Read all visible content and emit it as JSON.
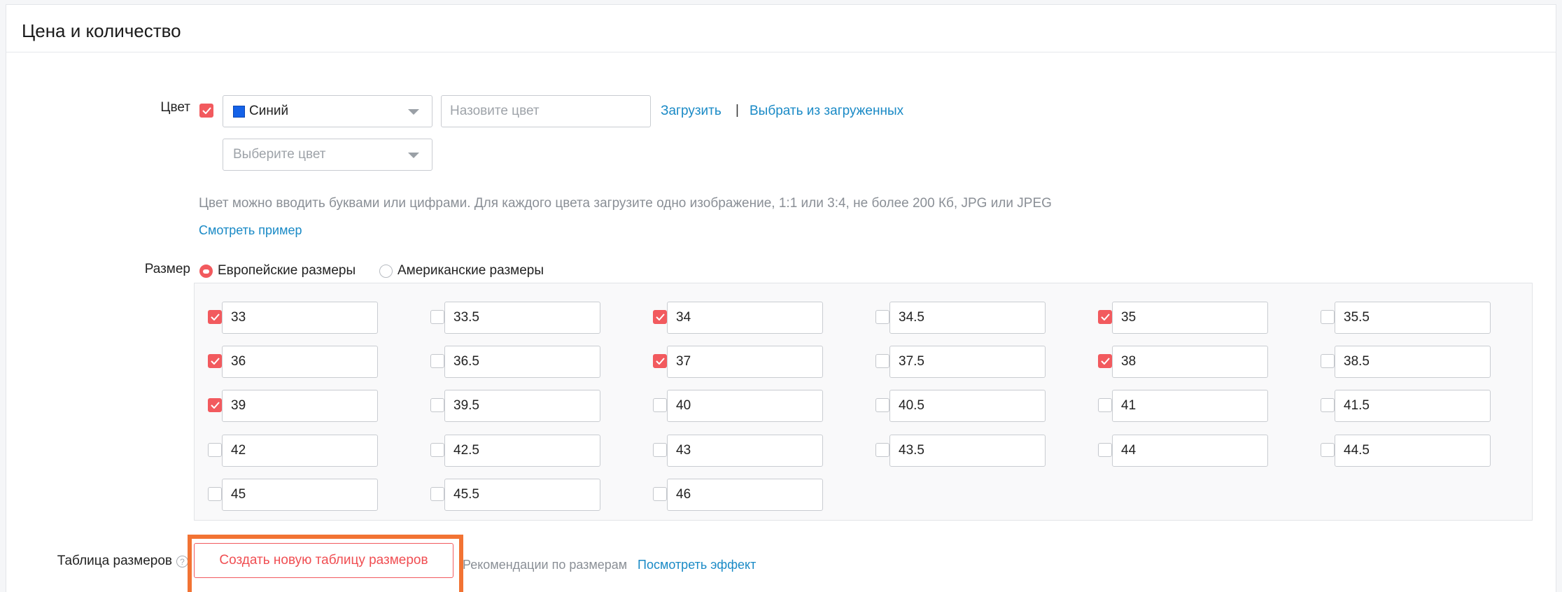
{
  "section": {
    "title": "Цена и количество"
  },
  "color": {
    "label": "Цвет",
    "checked": true,
    "selected": {
      "name": "Синий",
      "swatch": "#1462e8"
    },
    "name_placeholder": "Назовите цвет",
    "upload_link": "Загрузить",
    "separator": "|",
    "choose_uploaded_link": "Выбрать из загруженных",
    "second_select_placeholder": "Выберите цвет",
    "hint": "Цвет можно вводить буквами или цифрами. Для каждого цвета загрузите одно изображение, 1:1 или 3:4, не более 200 Кб, JPG или JPEG",
    "example_link": "Смотреть пример"
  },
  "size": {
    "label": "Размер",
    "options": [
      {
        "label": "Европейские размеры",
        "selected": true
      },
      {
        "label": "Американские размеры",
        "selected": false
      }
    ],
    "items": [
      {
        "value": "33",
        "checked": true
      },
      {
        "value": "33.5",
        "checked": false
      },
      {
        "value": "34",
        "checked": true
      },
      {
        "value": "34.5",
        "checked": false
      },
      {
        "value": "35",
        "checked": true
      },
      {
        "value": "35.5",
        "checked": false
      },
      {
        "value": "36",
        "checked": true
      },
      {
        "value": "36.5",
        "checked": false
      },
      {
        "value": "37",
        "checked": true
      },
      {
        "value": "37.5",
        "checked": false
      },
      {
        "value": "38",
        "checked": true
      },
      {
        "value": "38.5",
        "checked": false
      },
      {
        "value": "39",
        "checked": true
      },
      {
        "value": "39.5",
        "checked": false
      },
      {
        "value": "40",
        "checked": false
      },
      {
        "value": "40.5",
        "checked": false
      },
      {
        "value": "41",
        "checked": false
      },
      {
        "value": "41.5",
        "checked": false
      },
      {
        "value": "42",
        "checked": false
      },
      {
        "value": "42.5",
        "checked": false
      },
      {
        "value": "43",
        "checked": false
      },
      {
        "value": "43.5",
        "checked": false
      },
      {
        "value": "44",
        "checked": false
      },
      {
        "value": "44.5",
        "checked": false
      },
      {
        "value": "45",
        "checked": false
      },
      {
        "value": "45.5",
        "checked": false
      },
      {
        "value": "46",
        "checked": false
      }
    ]
  },
  "size_table": {
    "label": "Таблица размеров",
    "help_icon": "question-circle-icon",
    "create_button": "Создать новую таблицу размеров",
    "recommendations": "Рекомендации по размерам",
    "view_effect_link": "Посмотреть эффект"
  },
  "colors": {
    "accent": "#f25a5e",
    "link": "#1a8ac6",
    "highlight": "#f27333"
  }
}
